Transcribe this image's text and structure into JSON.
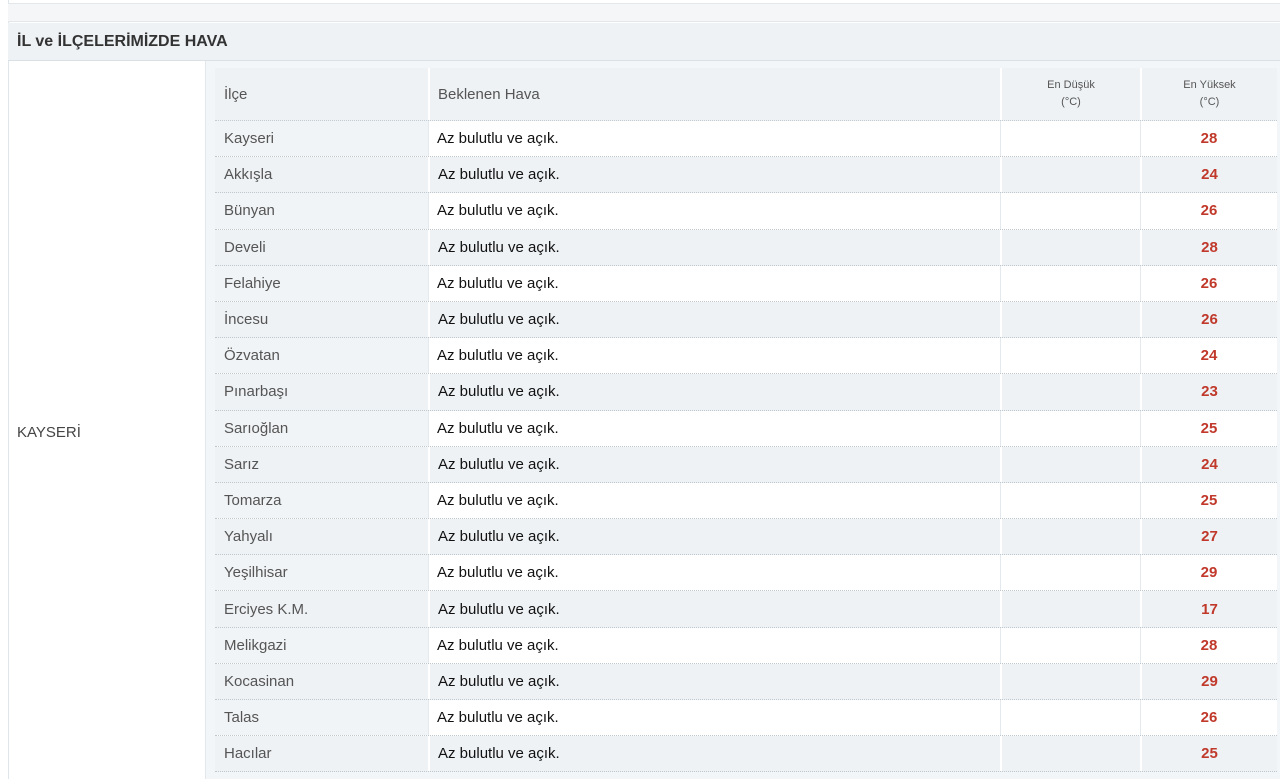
{
  "title": "İL ve İLÇELERİMİZDE HAVA",
  "province": "KAYSERİ",
  "columns": {
    "district": "İlçe",
    "forecast": "Beklenen Hava",
    "min_line1": "En Düşük",
    "min_line2": "(°C)",
    "max_line1": "En Yüksek",
    "max_line2": "(°C)"
  },
  "rows": [
    {
      "district": "Kayseri",
      "forecast": "Az bulutlu ve açık.",
      "max": "28"
    },
    {
      "district": "Akkışla",
      "forecast": "Az bulutlu ve açık.",
      "max": "24"
    },
    {
      "district": "Bünyan",
      "forecast": "Az bulutlu ve açık.",
      "max": "26"
    },
    {
      "district": "Develi",
      "forecast": "Az bulutlu ve açık.",
      "max": "28"
    },
    {
      "district": "Felahiye",
      "forecast": "Az bulutlu ve açık.",
      "max": "26"
    },
    {
      "district": "İncesu",
      "forecast": "Az bulutlu ve açık.",
      "max": "26"
    },
    {
      "district": "Özvatan",
      "forecast": "Az bulutlu ve açık.",
      "max": "24"
    },
    {
      "district": "Pınarbaşı",
      "forecast": "Az bulutlu ve açık.",
      "max": "23"
    },
    {
      "district": "Sarıoğlan",
      "forecast": "Az bulutlu ve açık.",
      "max": "25"
    },
    {
      "district": "Sarız",
      "forecast": "Az bulutlu ve açık.",
      "max": "24"
    },
    {
      "district": "Tomarza",
      "forecast": "Az bulutlu ve açık.",
      "max": "25"
    },
    {
      "district": "Yahyalı",
      "forecast": "Az bulutlu ve açık.",
      "max": "27"
    },
    {
      "district": "Yeşilhisar",
      "forecast": "Az bulutlu ve açık.",
      "max": "29"
    },
    {
      "district": "Erciyes K.M.",
      "forecast": "Az bulutlu ve açık.",
      "max": "17"
    },
    {
      "district": "Melikgazi",
      "forecast": "Az bulutlu ve açık.",
      "max": "28"
    },
    {
      "district": "Kocasinan",
      "forecast": "Az bulutlu ve açık.",
      "max": "29"
    },
    {
      "district": "Talas",
      "forecast": "Az bulutlu ve açık.",
      "max": "26"
    },
    {
      "district": "Hacılar",
      "forecast": "Az bulutlu ve açık.",
      "max": "25"
    }
  ],
  "colors": {
    "max_temp": "#c0392b",
    "header_bg": "#eef2f5"
  }
}
